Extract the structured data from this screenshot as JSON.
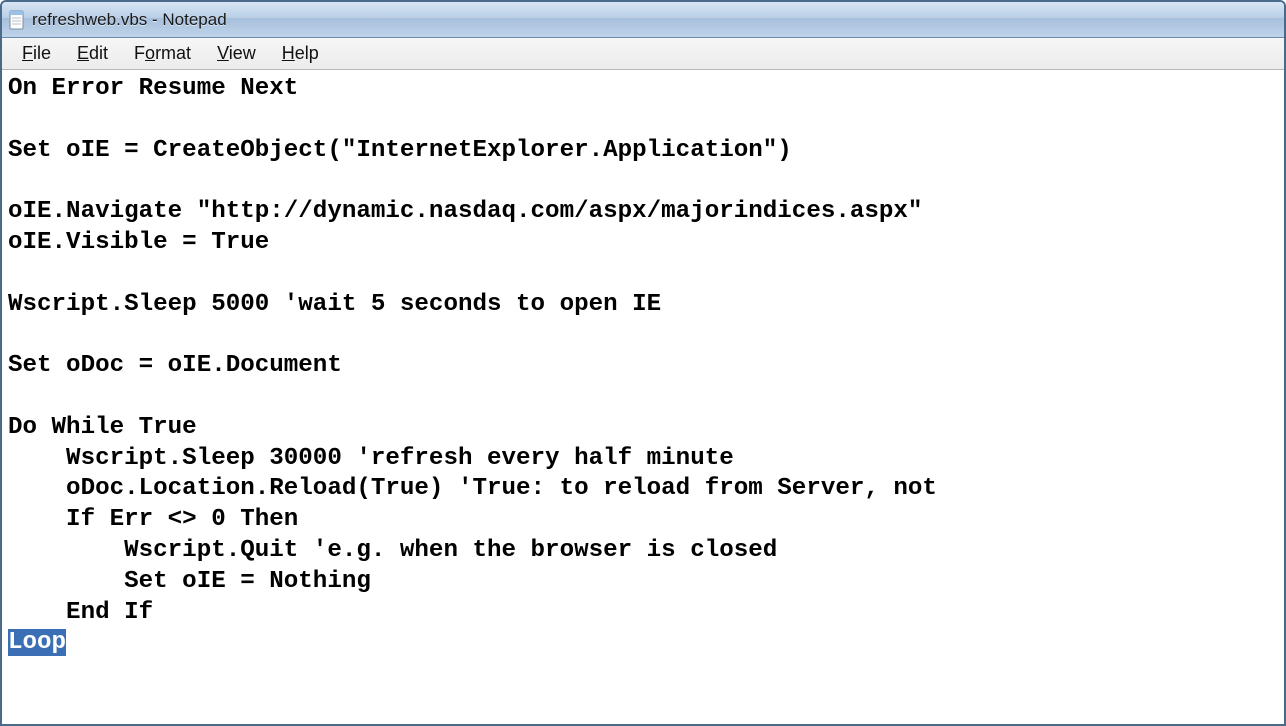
{
  "window": {
    "title": "refreshweb.vbs - Notepad",
    "icon_name": "notepad-icon"
  },
  "menu": {
    "file": {
      "label": "File",
      "accel_index": 0
    },
    "edit": {
      "label": "Edit",
      "accel_index": 0
    },
    "format": {
      "label": "Format",
      "accel_index": 1
    },
    "view": {
      "label": "View",
      "accel_index": 0
    },
    "help": {
      "label": "Help",
      "accel_index": 0
    }
  },
  "editor": {
    "lines": [
      "On Error Resume Next",
      "",
      "Set oIE = CreateObject(\"InternetExplorer.Application\")",
      "",
      "oIE.Navigate \"http://dynamic.nasdaq.com/aspx/majorindices.aspx\"",
      "oIE.Visible = True",
      "",
      "Wscript.Sleep 5000 'wait 5 seconds to open IE",
      "",
      "Set oDoc = oIE.Document",
      "",
      "Do While True",
      "    Wscript.Sleep 30000 'refresh every half minute",
      "    oDoc.Location.Reload(True) 'True: to reload from Server, not ",
      "    If Err <> 0 Then",
      "        Wscript.Quit 'e.g. when the browser is closed",
      "        Set oIE = Nothing",
      "    End If"
    ],
    "last_line_prefix": "",
    "last_line_selected": "Loop"
  }
}
